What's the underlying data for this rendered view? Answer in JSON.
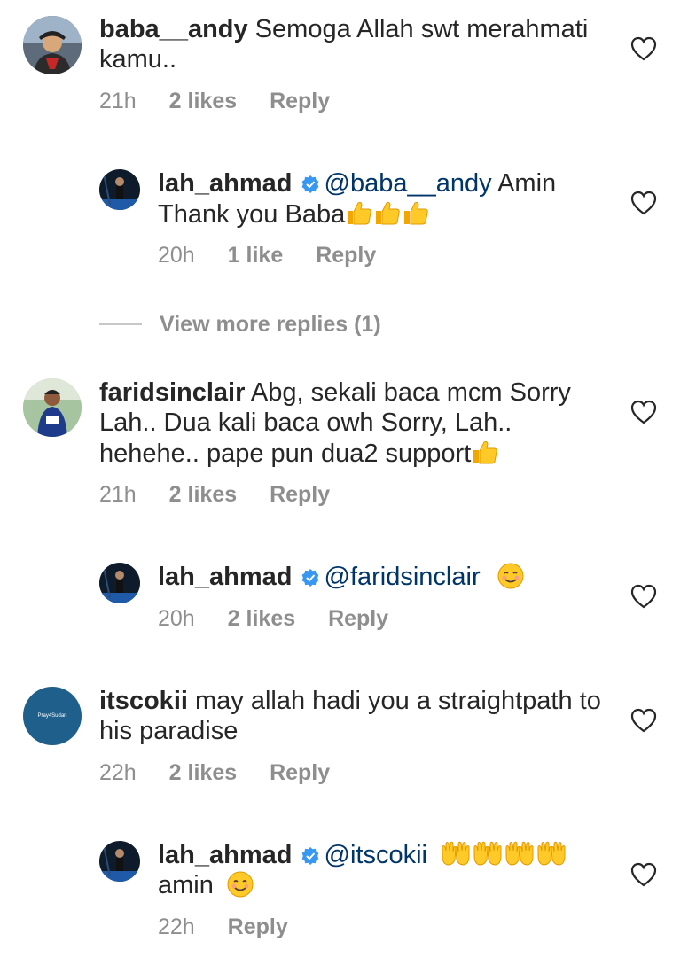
{
  "comments": [
    {
      "username": "baba__andy",
      "text": "Semoga Allah swt merahmati kamu..",
      "time": "21h",
      "likes": "2 likes",
      "reply": "Reply"
    },
    {
      "username": "lah_ahmad",
      "mention": "@baba__andy",
      "text": "Amin Thank you Baba",
      "time": "20h",
      "likes": "1 like",
      "reply": "Reply"
    },
    {
      "username": "faridsinclair",
      "text": "Abg, sekali baca mcm Sorry Lah.. Dua kali baca owh Sorry, Lah.. hehehe.. pape pun dua2 support",
      "time": "21h",
      "likes": "2 likes",
      "reply": "Reply"
    },
    {
      "username": "lah_ahmad",
      "mention": "@faridsinclair",
      "time": "20h",
      "likes": "2 likes",
      "reply": "Reply"
    },
    {
      "username": "itscokii",
      "text": "may allah hadi you a straightpath to his paradise",
      "time": "22h",
      "likes": "2 likes",
      "reply": "Reply",
      "avatar_text": "Pray4Sudan"
    },
    {
      "username": "lah_ahmad",
      "mention": "@itscokii",
      "text": "amin",
      "time": "22h",
      "reply": "Reply"
    }
  ],
  "view_more": "View more replies (1)",
  "colors": {
    "mention": "#003569",
    "meta": "#8e8e8e",
    "verified": "#3897f0"
  }
}
